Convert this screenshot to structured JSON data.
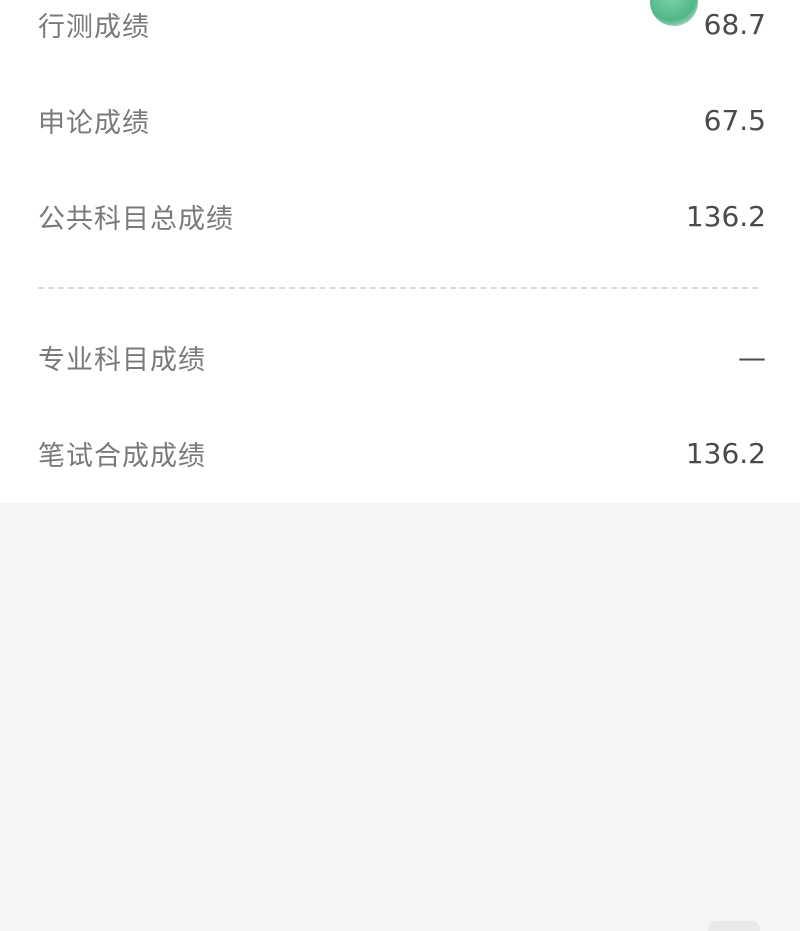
{
  "scores": {
    "rows": [
      {
        "label": "行测成绩",
        "value": "68.7"
      },
      {
        "label": "申论成绩",
        "value": "67.5"
      },
      {
        "label": "公共科目总成绩",
        "value": "136.2"
      },
      {
        "label": "专业科目成绩",
        "value": "—"
      },
      {
        "label": "笔试合成成绩",
        "value": "136.2"
      }
    ]
  },
  "colors": {
    "label_text": "#7a7a7a",
    "value_text": "#4a4a4a",
    "card_bg": "#ffffff",
    "page_bg": "#f5f5f5",
    "accent_blob": "#3fae7a"
  }
}
